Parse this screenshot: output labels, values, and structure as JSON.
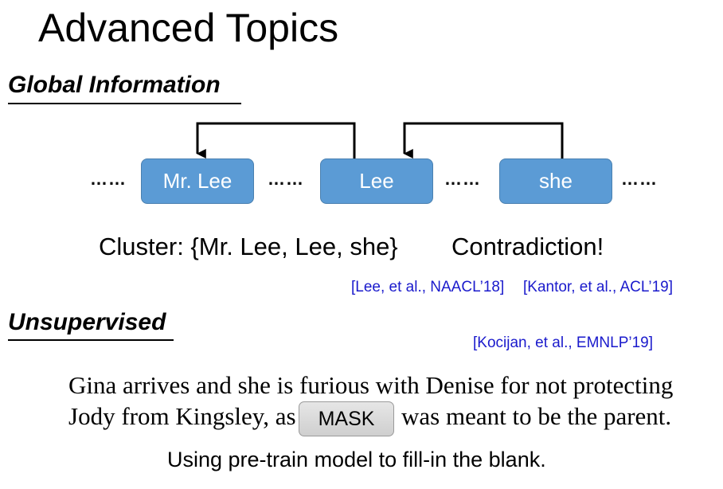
{
  "title": "Advanced Topics",
  "sections": {
    "global": "Global Information",
    "unsupervised": "Unsupervised"
  },
  "diagram": {
    "ellipsis": "……",
    "boxes": [
      "Mr. Lee",
      "Lee",
      "she"
    ],
    "box_color": "#5b9bd5",
    "cluster": "Cluster: {Mr. Lee, Lee, she}",
    "contradiction": "Contradiction!"
  },
  "citations": {
    "lee": "[Lee, et al., NAACL’18]",
    "kantor": "[Kantor, et al., ACL’19]",
    "kocijan": "[Kocijan, et al., EMNLP’19]",
    "color": "#1a1acc"
  },
  "example": {
    "line1": "Gina arrives and she is furious with Denise for not protecting",
    "line2_before": "Jody from Kingsley, as",
    "mask": "MASK",
    "line2_after": "was meant to be the parent."
  },
  "footer": "Using pre-train model to fill-in the blank."
}
